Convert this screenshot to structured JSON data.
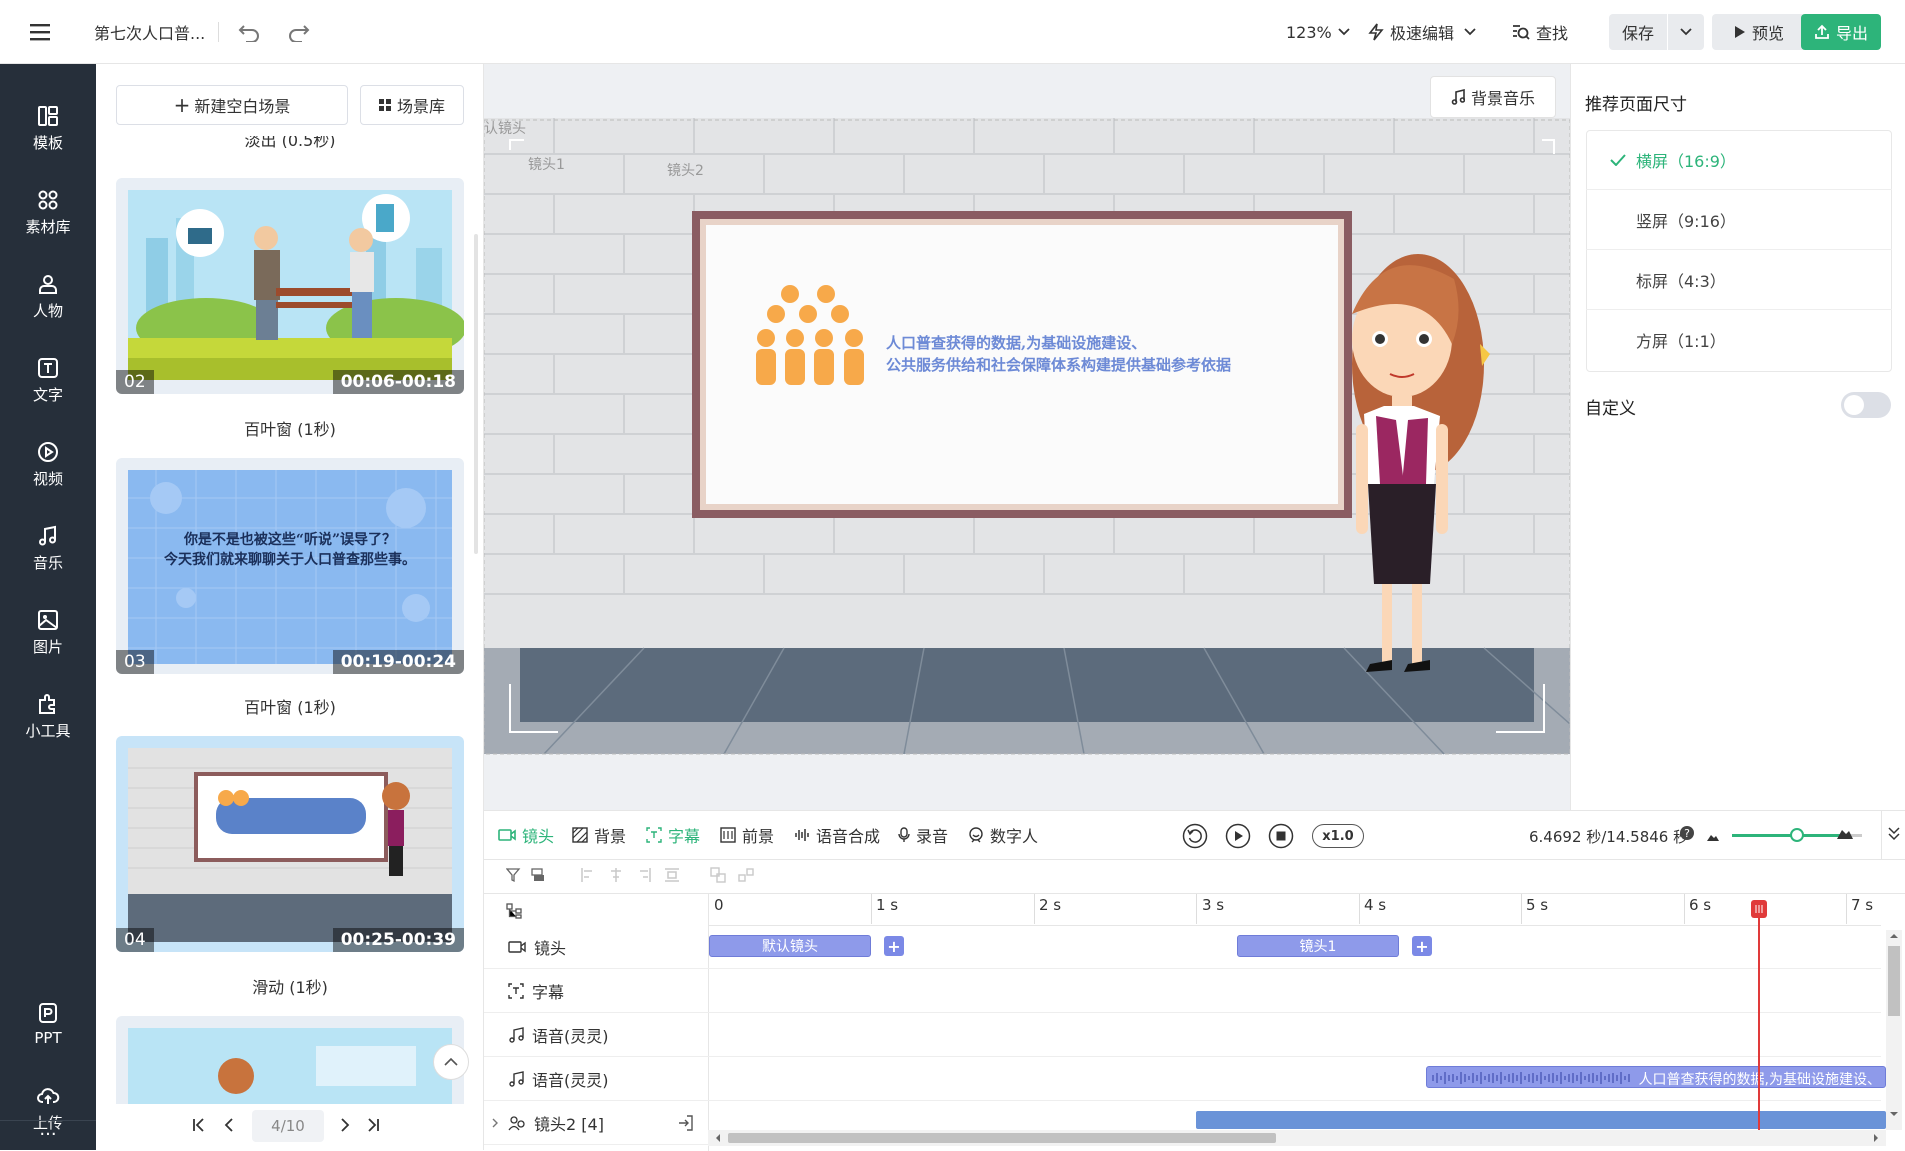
{
  "topbar": {
    "project_title": "第七次人口普...",
    "zoom": "123%",
    "mode": "极速编辑",
    "search": "查找",
    "save": "保存",
    "preview": "预览",
    "export": "导出"
  },
  "rail": {
    "items": [
      "模板",
      "素材库",
      "人物",
      "文字",
      "视频",
      "音乐",
      "图片",
      "小工具"
    ],
    "bottom": [
      "PPT",
      "上传"
    ],
    "more": "···"
  },
  "scenes": {
    "new_blank": "新建空白场景",
    "library": "场景库",
    "cut_top_label": "淡出 (0.5秒)",
    "cards": [
      {
        "num": "02",
        "time": "00:06-00:18",
        "transition": "百叶窗 (1秒)"
      },
      {
        "num": "03",
        "time": "00:19-00:24",
        "transition": "百叶窗 (1秒)",
        "text_line1": "你是不是也被这些“听说”误导了？",
        "text_line2": "今天我们就来聊聊关于人口普查那些事。"
      },
      {
        "num": "04",
        "time": "00:25-00:39",
        "transition": "滑动 (1秒)"
      }
    ],
    "pager": "4/10"
  },
  "canvas": {
    "bg_music": "背景音乐",
    "default_shot": "默认镜头",
    "shot1": "镜头1",
    "shot2": "镜头2",
    "board_line1": "人口普查获得的数据,为基础设施建设、",
    "board_line2": "公共服务供给和社会保障体系构建提供基础参考依据"
  },
  "right_panel": {
    "title": "推荐页面尺寸",
    "options": [
      "横屏（16:9）",
      "竖屏（9:16）",
      "标屏（4:3）",
      "方屏（1:1）"
    ],
    "selected_index": 0,
    "custom": "自定义"
  },
  "timeline": {
    "tabs": [
      "镜头",
      "背景",
      "字幕",
      "前景",
      "语音合成",
      "录音",
      "数字人"
    ],
    "speed": "x1.0",
    "time_readout": "6.4692 秒/14.5846 秒",
    "ticks": [
      "0",
      "1 s",
      "2 s",
      "3 s",
      "4 s",
      "5 s",
      "6 s",
      "7 s"
    ],
    "tracks": [
      "镜头",
      "字幕",
      "语音(灵灵)",
      "语音(灵灵)",
      "镜头2 [4]"
    ],
    "clip_default": "默认镜头",
    "clip_shot1": "镜头1",
    "voice_text": "人口普查获得的数据,为基础设施建设、"
  },
  "colors": {
    "rail_bg": "#262f3a",
    "accent_green": "#2db47a",
    "clip_purple": "#8e9aea",
    "playhead_red": "#e03a3a"
  }
}
